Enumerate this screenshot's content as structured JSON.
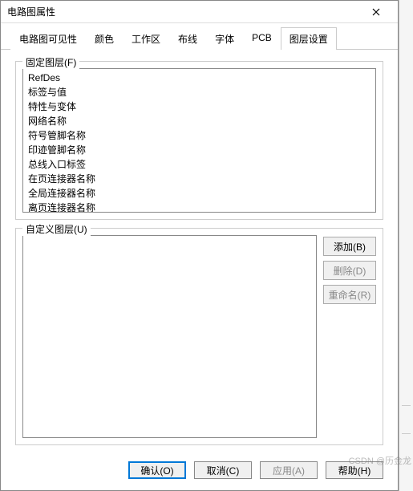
{
  "dialog": {
    "title": "电路图属性"
  },
  "tabs": [
    {
      "label": "电路图可见性"
    },
    {
      "label": "颜色"
    },
    {
      "label": "工作区"
    },
    {
      "label": "布线"
    },
    {
      "label": "字体"
    },
    {
      "label": "PCB"
    },
    {
      "label": "图层设置"
    }
  ],
  "active_tab_index": 6,
  "fixed_layers": {
    "label": "固定图层(F)",
    "items": [
      "RefDes",
      "标签与值",
      "特性与变体",
      "网络名称",
      "符号管脚名称",
      "印迹管脚名称",
      "总线入口标签",
      "在页连接器名称",
      "全局连接器名称",
      "离页连接器名称"
    ]
  },
  "custom_layers": {
    "label": "自定义图层(U)"
  },
  "side_buttons": {
    "add": "添加(B)",
    "delete": "删除(D)",
    "rename": "重命名(R)"
  },
  "bottom": {
    "ok": "确认(O)",
    "cancel": "取消(C)",
    "apply": "应用(A)",
    "help": "帮助(H)"
  },
  "watermark": "CSDN @历金龙"
}
